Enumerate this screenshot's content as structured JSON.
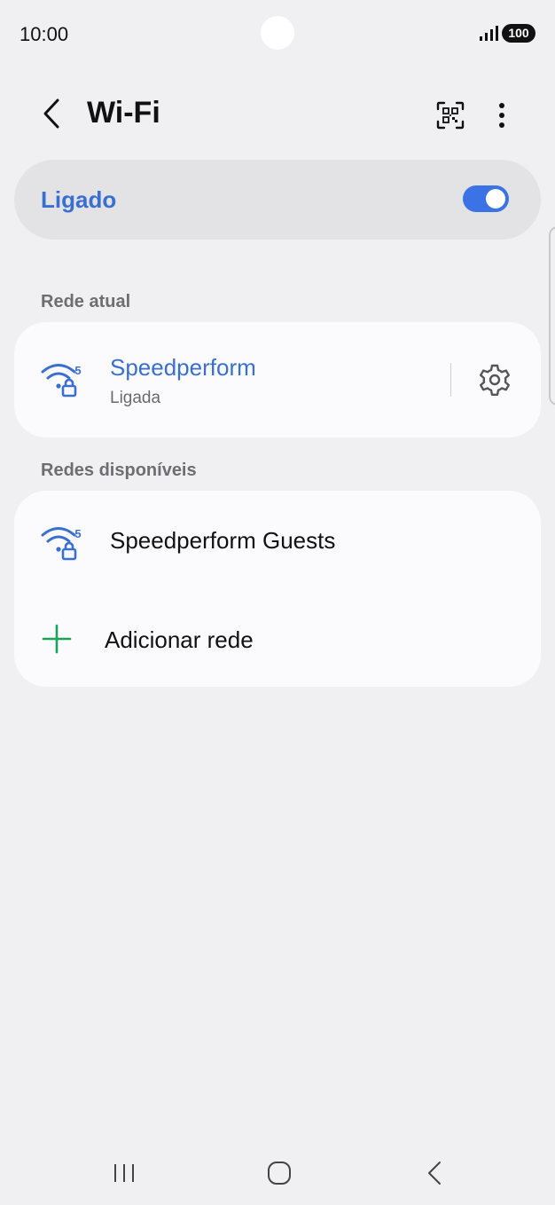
{
  "status_bar": {
    "time": "10:00",
    "battery": "100",
    "icons": [
      "signal-icon",
      "battery-icon"
    ]
  },
  "app_bar": {
    "title": "Wi-Fi",
    "icons": [
      "back-arrow-icon",
      "qr-code-icon",
      "more-vert-icon"
    ]
  },
  "master_switch": {
    "label": "Ligado",
    "on": true,
    "accent_color": "#3b73e6",
    "label_color": "#3a6fd1"
  },
  "current_network": {
    "section_label": "Rede atual",
    "name": "Speedperform",
    "status": "Ligada",
    "band": "5",
    "icons": [
      "wifi-locked-icon",
      "settings-gear-icon"
    ]
  },
  "available_networks": {
    "section_label": "Redes disponíveis",
    "items": [
      {
        "name": "Speedperform Guests",
        "band": "5",
        "icon": "wifi-locked-icon"
      }
    ],
    "add_network": {
      "label": "Adicionar rede",
      "icon": "plus-icon",
      "icon_color": "#1aa35a"
    }
  },
  "nav_bar": {
    "icons": [
      "recents-icon",
      "home-icon",
      "nav-back-icon"
    ]
  }
}
